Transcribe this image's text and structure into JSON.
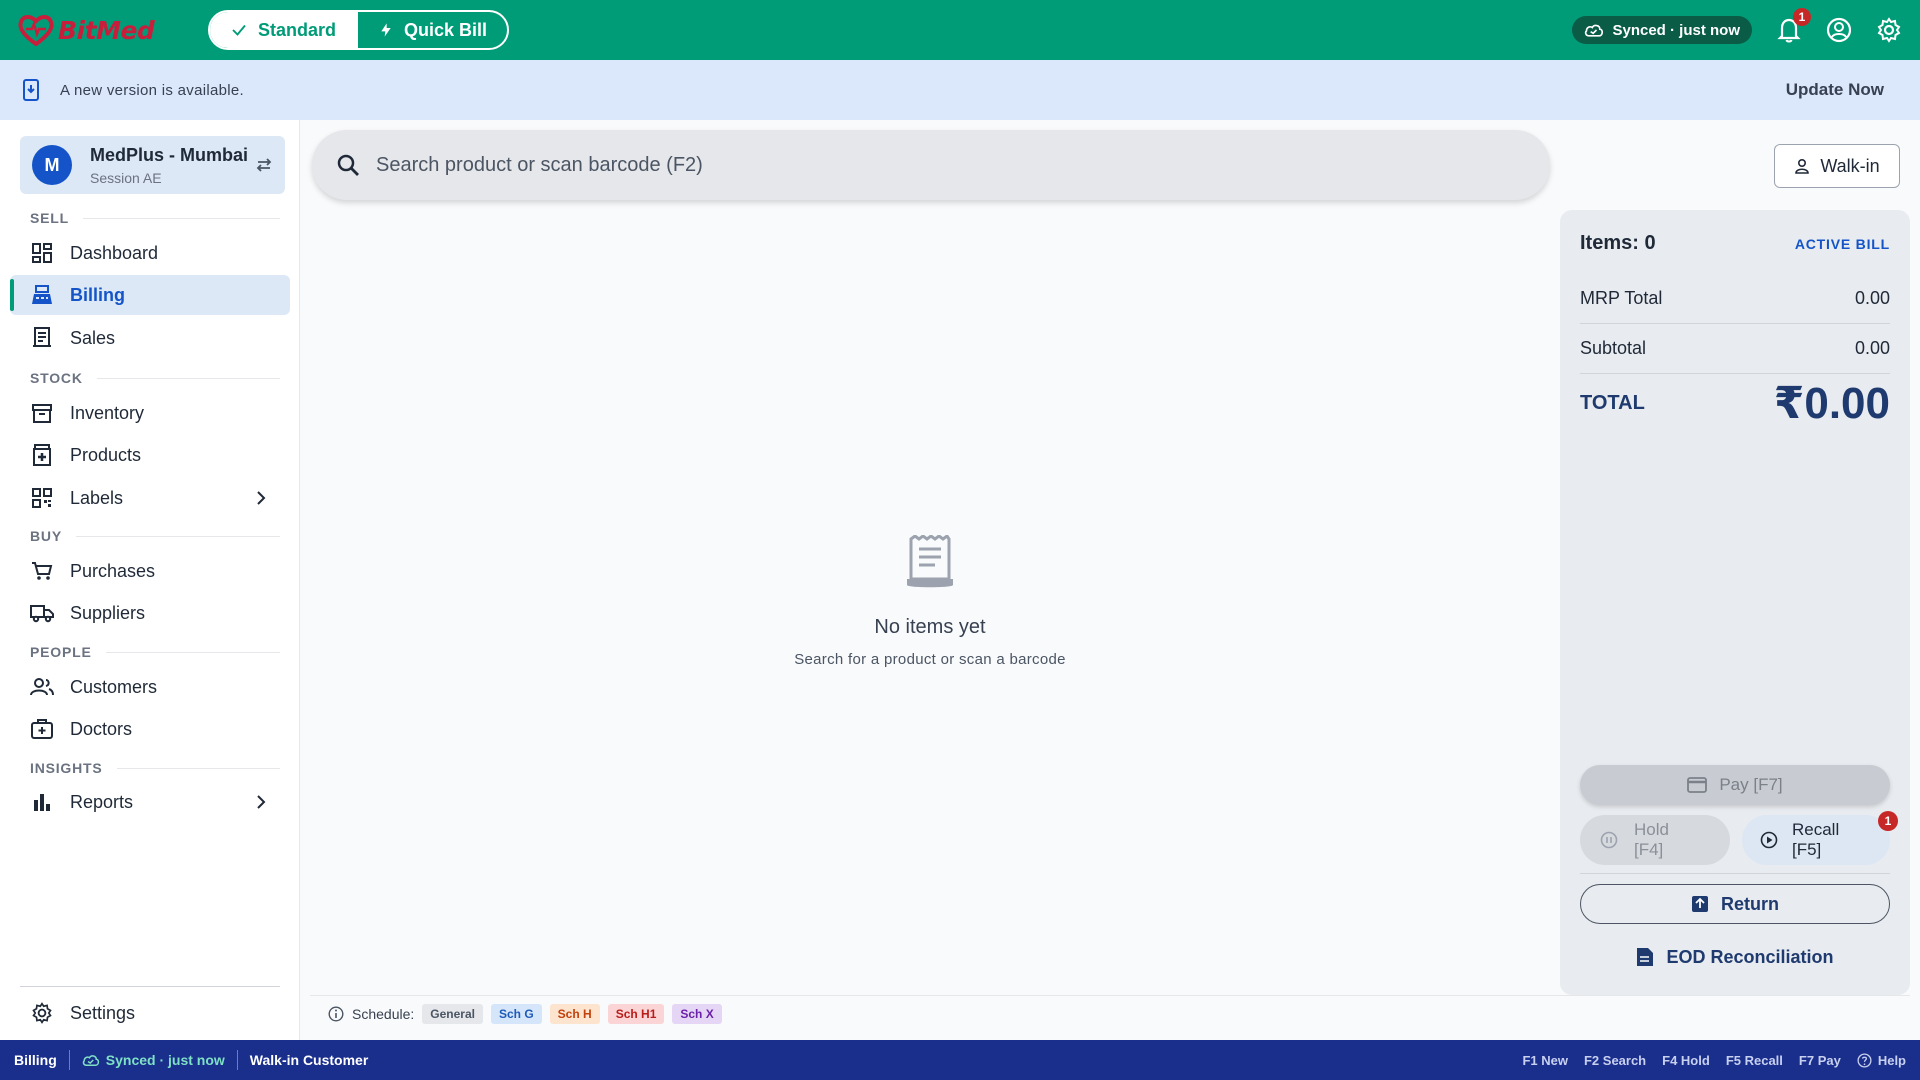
{
  "app": {
    "logo_text": "BitMed"
  },
  "header": {
    "modes": [
      {
        "label": "Standard",
        "active": true
      },
      {
        "label": "Quick Bill",
        "active": false
      }
    ],
    "sync_status": "Synced · just now",
    "notification_count": "1"
  },
  "banner": {
    "message": "A new version is available.",
    "action_label": "Update Now"
  },
  "sidebar": {
    "store": {
      "avatar_initial": "M",
      "name": "MedPlus - Mumbai",
      "session": "Session AE"
    },
    "sections": {
      "sell": "SELL",
      "stock": "STOCK",
      "buy": "BUY",
      "people": "PEOPLE",
      "insights": "INSIGHTS"
    },
    "items": {
      "dashboard": "Dashboard",
      "billing": "Billing",
      "sales": "Sales",
      "inventory": "Inventory",
      "products": "Products",
      "labels": "Labels",
      "purchases": "Purchases",
      "suppliers": "Suppliers",
      "customers": "Customers",
      "doctors": "Doctors",
      "reports": "Reports",
      "settings": "Settings"
    },
    "active_item": "Billing"
  },
  "search": {
    "placeholder": "Search product or scan barcode (F2)"
  },
  "customer_button": {
    "label": "Walk-in"
  },
  "empty_state": {
    "title": "No items yet",
    "subtitle": "Search for a product or scan a barcode"
  },
  "bill": {
    "items_label": "Items: 0",
    "status_label": "ACTIVE BILL",
    "mrp_total_label": "MRP Total",
    "mrp_total_value": "0.00",
    "subtotal_label": "Subtotal",
    "subtotal_value": "0.00",
    "total_label": "TOTAL",
    "total_value": "₹0.00",
    "pay_label": "Pay [F7]",
    "hold_line1": "Hold",
    "hold_line2": "[F4]",
    "recall_line1": "Recall",
    "recall_line2": "[F5]",
    "recall_badge": "1",
    "return_label": "Return",
    "eod_label": "EOD Reconciliation"
  },
  "schedule": {
    "label": "Schedule:",
    "chips": [
      {
        "label": "General",
        "bg": "#e5e7eb",
        "fg": "#4b5563"
      },
      {
        "label": "Sch G",
        "bg": "#d6e6fa",
        "fg": "#1e5bb8"
      },
      {
        "label": "Sch H",
        "bg": "#fde4cf",
        "fg": "#c2410c"
      },
      {
        "label": "Sch H1",
        "bg": "#fbd5d5",
        "fg": "#b91c1c"
      },
      {
        "label": "Sch X",
        "bg": "#e6d6f5",
        "fg": "#6b21a8"
      }
    ]
  },
  "statusbar": {
    "page": "Billing",
    "sync": "Synced · just now",
    "customer": "Walk-in Customer",
    "shortcuts": [
      "F1 New",
      "F2 Search",
      "F4 Hold",
      "F5 Recall",
      "F7 Pay"
    ],
    "help": "Help"
  },
  "colors": {
    "brand_green": "#009b77",
    "primary_blue": "#1454c8",
    "status_navy": "#1a2e8c",
    "badge_red": "#c62828"
  }
}
